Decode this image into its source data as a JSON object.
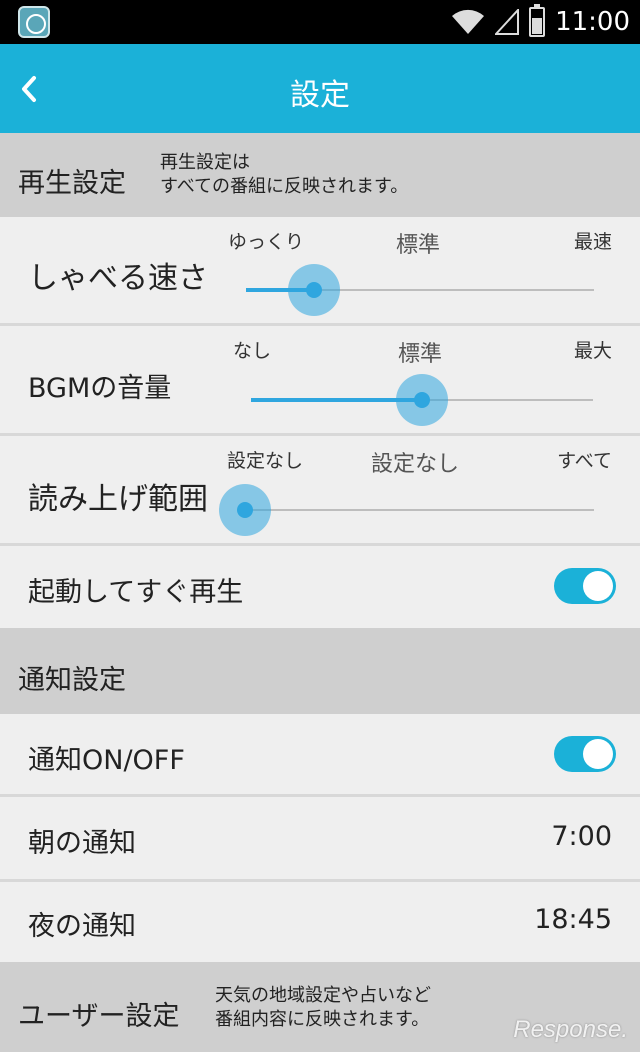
{
  "status_bar": {
    "time": "11:00",
    "icons": [
      "app-icon",
      "wifi-icon",
      "signal-icon",
      "battery-icon"
    ]
  },
  "app_bar": {
    "title": "設定",
    "back_icon": "chevron-left-icon"
  },
  "playback_section": {
    "title": "再生設定",
    "description_line1": "再生設定は",
    "description_line2": "すべての番組に反映されます。"
  },
  "speech_speed": {
    "label": "しゃべる速さ",
    "min_label": "ゆっくり",
    "current_label": "標準",
    "max_label": "最速",
    "value_fraction": 0.2
  },
  "bgm_volume": {
    "label": "BGMの音量",
    "min_label": "なし",
    "current_label": "標準",
    "max_label": "最大",
    "value_fraction": 0.5
  },
  "read_range": {
    "label": "読み上げ範囲",
    "min_label": "設定なし",
    "current_label": "設定なし",
    "max_label": "すべて",
    "value_fraction": 0.0
  },
  "autoplay": {
    "label": "起動してすぐ再生",
    "enabled": true
  },
  "notification_section": {
    "title": "通知設定"
  },
  "notification_toggle": {
    "label": "通知ON/OFF",
    "enabled": true
  },
  "morning_notification": {
    "label": "朝の通知",
    "time": "7:00"
  },
  "evening_notification": {
    "label": "夜の通知",
    "time": "18:45"
  },
  "user_section": {
    "title": "ユーザー設定",
    "description_line1": "天気の地域設定や占いなど",
    "description_line2": "番組内容に反映されます。"
  },
  "watermark": "Response.",
  "colors": {
    "accent": "#1bb1d8",
    "slider": "#2fa6df",
    "section_bg": "#cfcfcf",
    "row_bg": "#efefef"
  }
}
